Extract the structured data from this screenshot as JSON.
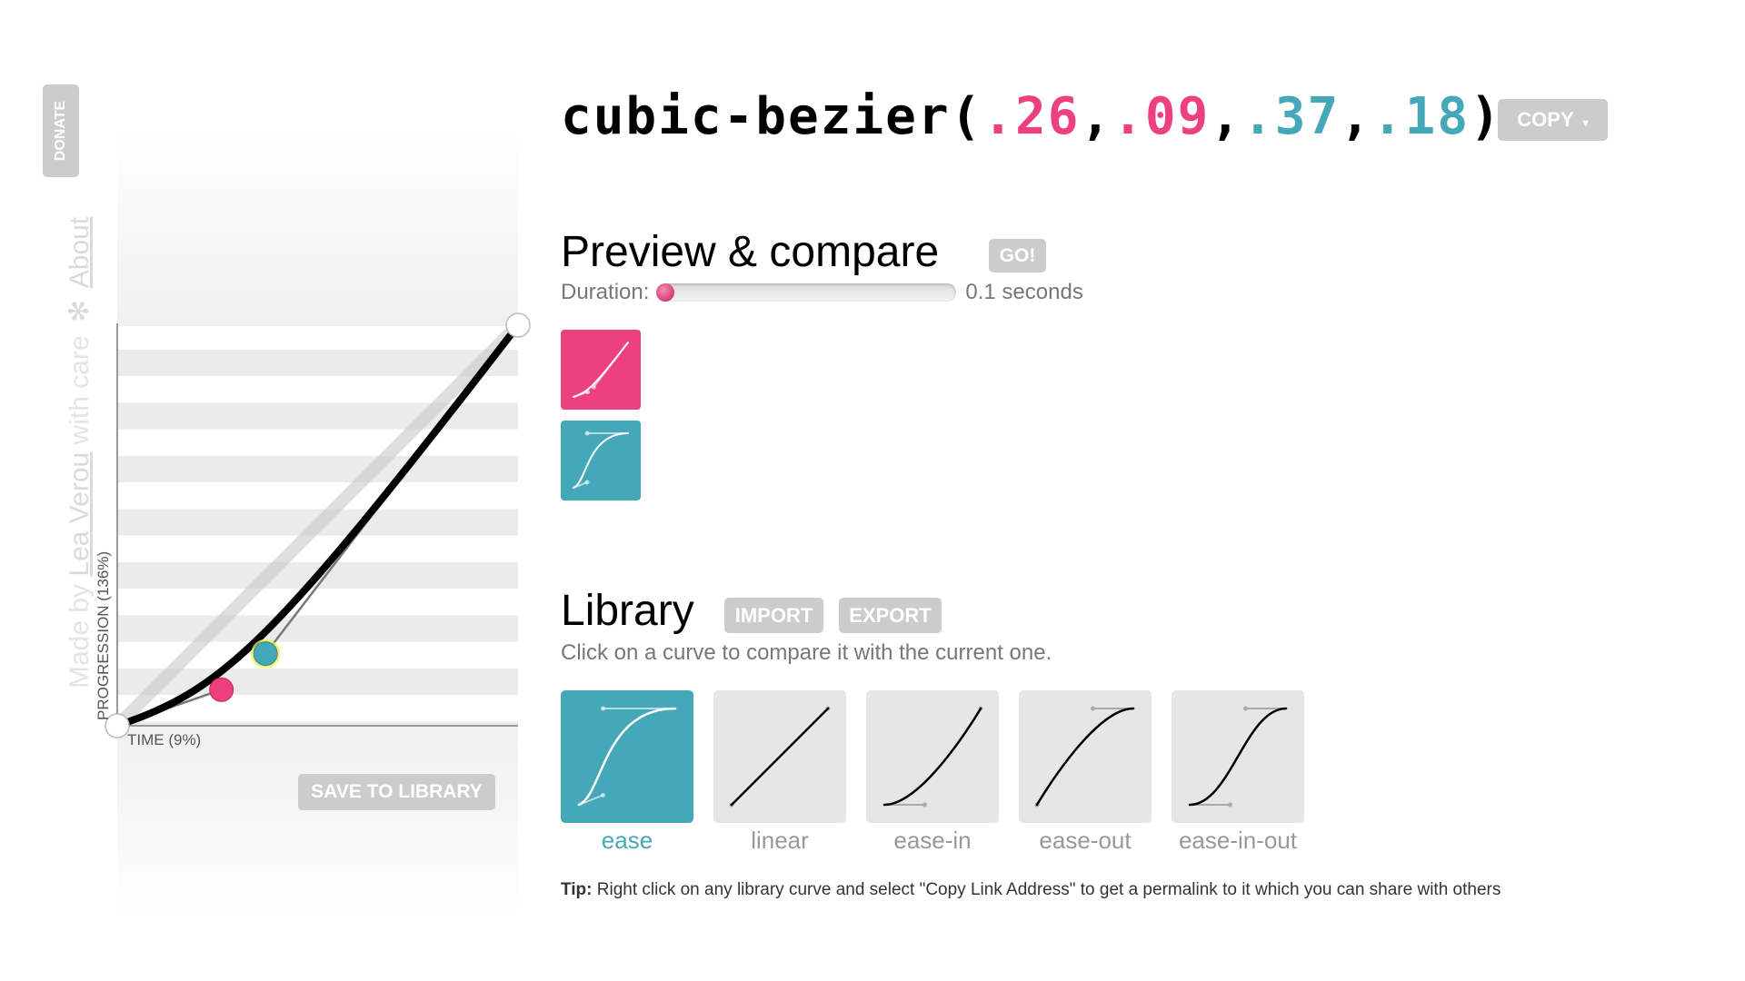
{
  "sidebar": {
    "donate_label": "DONATE",
    "credit_prefix": "Made by",
    "author": "Lea Verou",
    "credit_middle": "with care",
    "star": "✻",
    "about": "About"
  },
  "editor": {
    "bezier": [
      0.26,
      0.09,
      0.37,
      0.18
    ],
    "time_label": "TIME (9%)",
    "progression_label": "PROGRESSION (136%)",
    "save_label": "SAVE TO LIBRARY"
  },
  "header": {
    "fn": "cubic-bezier(",
    "p1x": ".26",
    "p1y": ".09",
    "p2x": ".37",
    "p2y": ".18",
    "sep": ",",
    "close": ")",
    "copy_label": "COPY",
    "copy_caret": "▾"
  },
  "preview": {
    "title": "Preview & compare",
    "go_label": "GO!",
    "duration_label": "Duration:",
    "duration_value": "0.1 seconds",
    "slider_fraction": 0
  },
  "library": {
    "title": "Library",
    "import_label": "IMPORT",
    "export_label": "EXPORT",
    "subtitle": "Click on a curve to compare it with the current one.",
    "items": [
      {
        "name": "ease",
        "bezier": [
          0.25,
          0.1,
          0.25,
          1
        ],
        "active": true
      },
      {
        "name": "linear",
        "bezier": [
          0,
          0,
          1,
          1
        ],
        "active": false
      },
      {
        "name": "ease-in",
        "bezier": [
          0.42,
          0,
          1,
          1
        ],
        "active": false
      },
      {
        "name": "ease-out",
        "bezier": [
          0,
          0,
          0.58,
          1
        ],
        "active": false
      },
      {
        "name": "ease-in-out",
        "bezier": [
          0.42,
          0,
          0.58,
          1
        ],
        "active": false
      }
    ],
    "tip_label": "Tip:",
    "tip_text": " Right click on any library curve and select \"Copy Link Address\" to get a permalink to it which you can share with others"
  },
  "colors": {
    "p1": "#ec407f",
    "p2": "#45a8b8",
    "button": "#cccccc"
  }
}
